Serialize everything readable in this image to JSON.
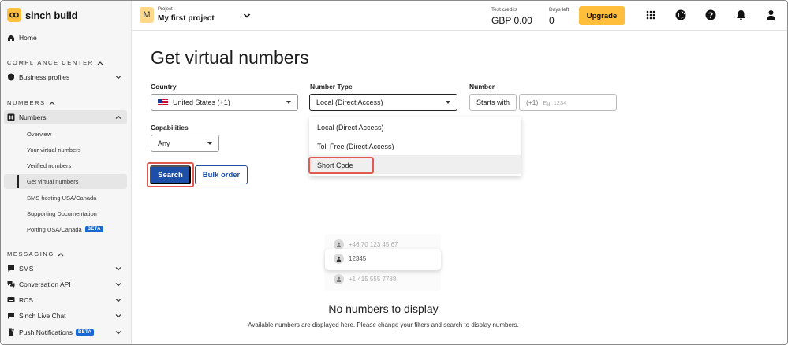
{
  "app": {
    "brand": "sinch build"
  },
  "sidebar": {
    "home": "Home",
    "compliance_label": "COMPLIANCE CENTER",
    "business_profiles": "Business profiles",
    "numbers_label": "NUMBERS",
    "numbers": "Numbers",
    "numbers_sub": [
      "Overview",
      "Your virtual numbers",
      "Verified numbers",
      "Get virtual numbers",
      "SMS hosting USA/Canada",
      "Supporting Documentation",
      "Porting USA/Canada"
    ],
    "beta": "BETA",
    "messaging_label": "MESSAGING",
    "sms": "SMS",
    "conversation_api": "Conversation API",
    "rcs": "RCS",
    "live_chat": "Sinch Live Chat",
    "push": "Push Notifications"
  },
  "topbar": {
    "project_small": "Project",
    "project_badge": "M",
    "project_name": "My first project",
    "credits_label": "Test credits",
    "credits_value": "GBP 0.00",
    "days_label": "Days left",
    "days_value": "0",
    "upgrade": "Upgrade"
  },
  "main": {
    "title": "Get virtual numbers",
    "country_label": "Country",
    "country_value": "United States (+1)",
    "number_type_label": "Number Type",
    "number_type_value": "Local (Direct Access)",
    "number_label": "Number",
    "number_match": "Starts with",
    "number_prefix": "(+1)",
    "number_placeholder": "Eg. 1234",
    "capabilities_label": "Capabilities",
    "capabilities_value": "Any",
    "dropdown_options": [
      "Local (Direct Access)",
      "Toll Free (Direct Access)",
      "Short Code"
    ],
    "search": "Search",
    "bulk_order": "Bulk order"
  },
  "empty_state": {
    "rows": [
      "+46 70 123 45 67",
      "12345",
      "+1 415 555 7788"
    ],
    "title": "No numbers to display",
    "subtitle": "Available numbers are displayed here. Please change your filters and search to display numbers."
  }
}
